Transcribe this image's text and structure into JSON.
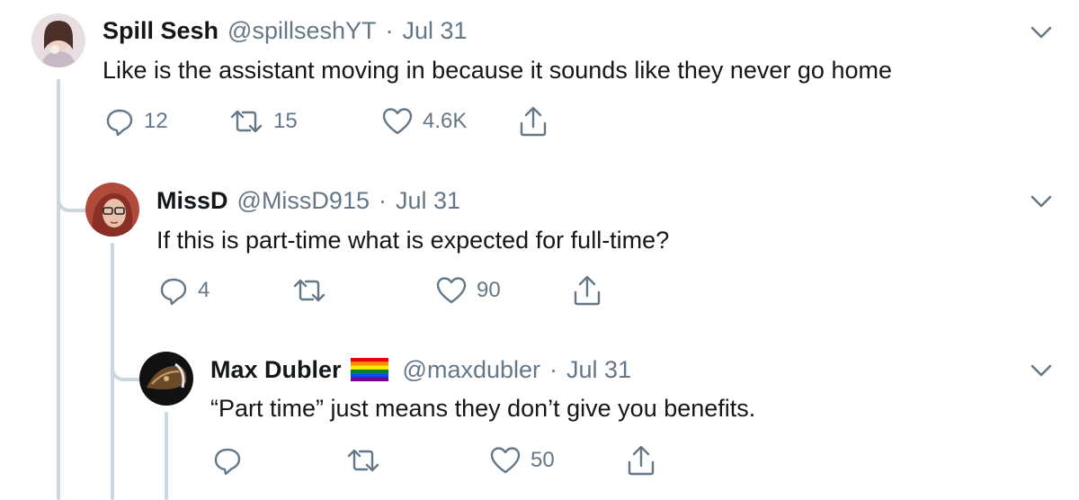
{
  "tweets": [
    {
      "name": "Spill Sesh",
      "handle": "@spillseshYT",
      "separator": "·",
      "date": "Jul 31",
      "text": "Like is the assistant moving in because it sounds like they never go home",
      "replies": "12",
      "retweets": "15",
      "likes": "4.6K"
    },
    {
      "name": "MissD",
      "handle": "@MissD915",
      "separator": "·",
      "date": "Jul 31",
      "text": "If this is part-time what is expected for full-time?",
      "replies": "4",
      "retweets": "",
      "likes": "90"
    },
    {
      "name": "Max Dubler",
      "handle": "@maxdubler",
      "separator": "·",
      "date": "Jul 31",
      "text": "“Part time” just means they don’t give you benefits.",
      "replies": "",
      "retweets": "",
      "likes": "50",
      "name_badge": "rainbow-flag-icon"
    }
  ],
  "colors": {
    "text": "#14171a",
    "secondary": "#657786",
    "thread_line": "#ccd6dd",
    "background": "#ffffff"
  },
  "icons": [
    "reply-icon",
    "retweet-icon",
    "like-icon",
    "share-icon",
    "chevron-down-icon",
    "rainbow-flag-icon"
  ]
}
